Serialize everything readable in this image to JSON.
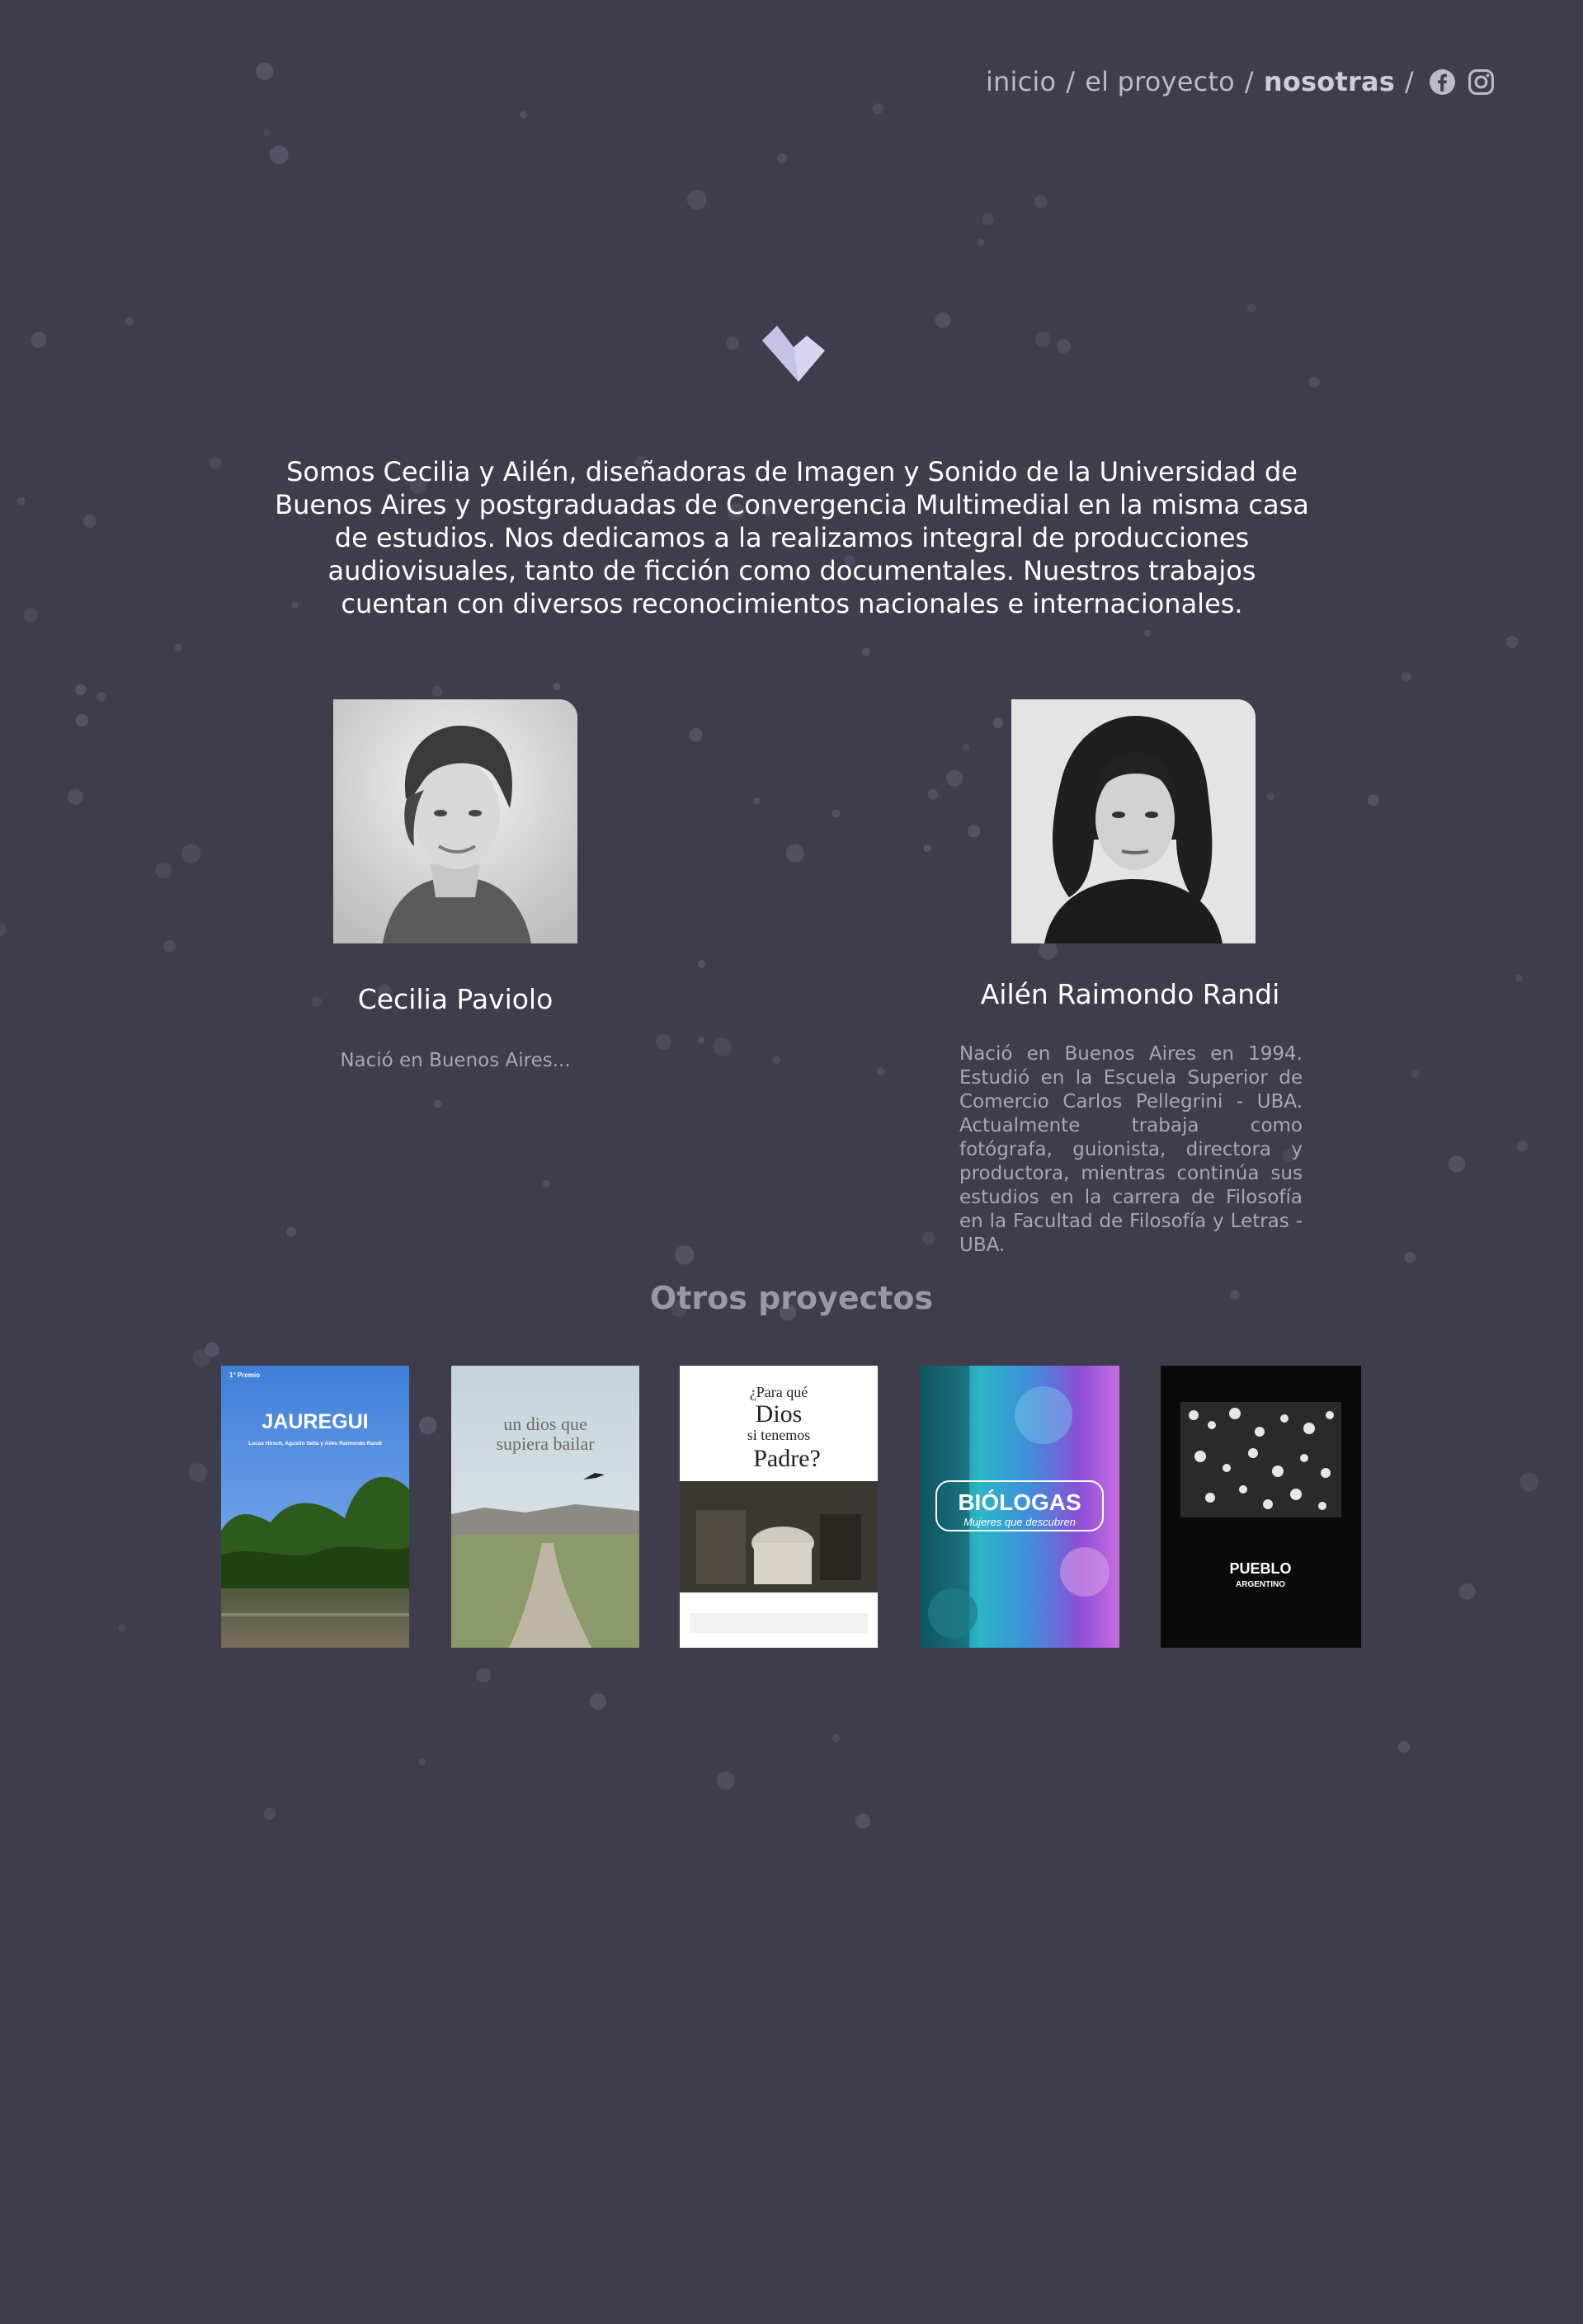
{
  "nav": {
    "items": [
      {
        "label": "inicio"
      },
      {
        "label": "el proyecto"
      },
      {
        "label": "nosotras"
      }
    ],
    "separator": "/",
    "social": [
      "facebook-icon",
      "instagram-icon"
    ]
  },
  "intro": {
    "text": "Somos Cecilia y Ailén, diseñadoras de Imagen y Sonido de la Universidad de Buenos Aires y postgraduadas de Convergencia Multimedial en la misma casa de estudios. Nos dedicamos a la realizamos integral de producciones audiovisuales, tanto de ficción como documentales. Nuestros trabajos cuentan con diversos reconocimientos nacionales e internacionales."
  },
  "members": [
    {
      "name": "Cecilia Paviolo",
      "bio": "Nació en Buenos Aires..."
    },
    {
      "name": "Ailén Raimondo Randi",
      "bio": "Nació en Buenos Aires en 1994. Estudió en la Escuela Superior de Comercio Carlos Pellegrini - UBA. Actualmente trabaja como fotógrafa, guionista, directora y productora, mientras continúa sus estudios en la carrera de  Filosofía en la Facultad de Filosofía y Letras - UBA."
    }
  ],
  "projects": {
    "title": "Otros proyectos",
    "posters": [
      {
        "title": "JAUREGUI",
        "award": "1° Premio",
        "credits": "Lucas Hirsch, Agustín Sella y Ailén Raimondo Randi"
      },
      {
        "title_line1": "un dios que",
        "title_line2": "supiera bailar"
      },
      {
        "title_line1": "¿Para qué",
        "title_line2": "Dios",
        "title_line3": "si tenemos",
        "title_line4": "Padre?"
      },
      {
        "title": "BIÓLOGAS",
        "subtitle": "Mujeres que descubren"
      },
      {
        "title_line1": "PUEBLO",
        "title_line2": "ARGENTINO"
      }
    ]
  },
  "colors": {
    "background": "#3f3c4c",
    "nav_text": "#bcb9c8",
    "muted_text": "#a9a6b5",
    "heading_muted": "#9a97a8",
    "logo": "#d6d4f0"
  }
}
